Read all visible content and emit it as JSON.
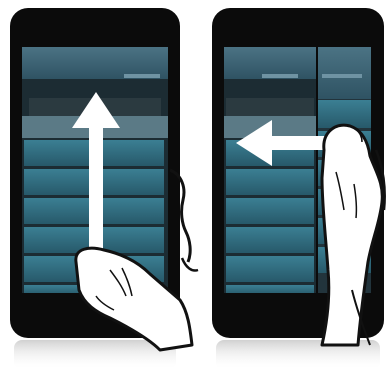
{
  "illustration": {
    "left_panel": {
      "gesture": "swipe-up",
      "icon": "hand-pointer-icon",
      "arrow_icon": "arrow-up-icon",
      "list_rows": 6
    },
    "right_panel": {
      "gesture": "swipe-left",
      "icon": "hand-pointer-icon",
      "arrow_icon": "arrow-left-icon",
      "list_rows": 6
    }
  },
  "colors": {
    "phone_body": "#0b0b0b",
    "screen_bg": "#1c2c33",
    "list_row": "#2f6a7c",
    "header": "#3d6070",
    "skin": "#ffffff",
    "outline": "#111111"
  }
}
